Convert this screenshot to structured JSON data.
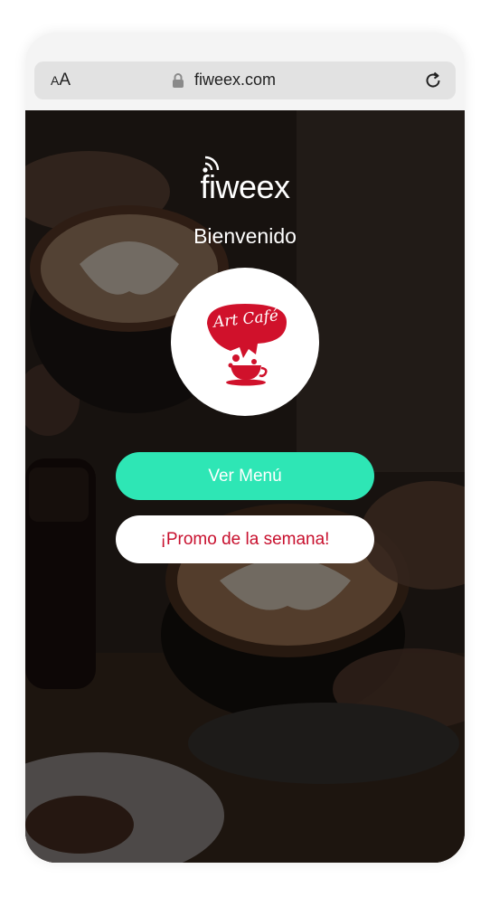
{
  "browser": {
    "text_size_label": "AA",
    "domain": "fiweex.com",
    "lock_icon": "lock-icon",
    "reload_icon": "reload-icon"
  },
  "page": {
    "brand": "fiweex",
    "welcome": "Bienvenido",
    "logo_text": "Art Café",
    "buttons": {
      "menu": "Ver Menú",
      "promo": "¡Promo de la semana!"
    }
  },
  "colors": {
    "accent": "#2ee6b5",
    "promo_text": "#c8102e",
    "logo_red": "#d0112b"
  }
}
